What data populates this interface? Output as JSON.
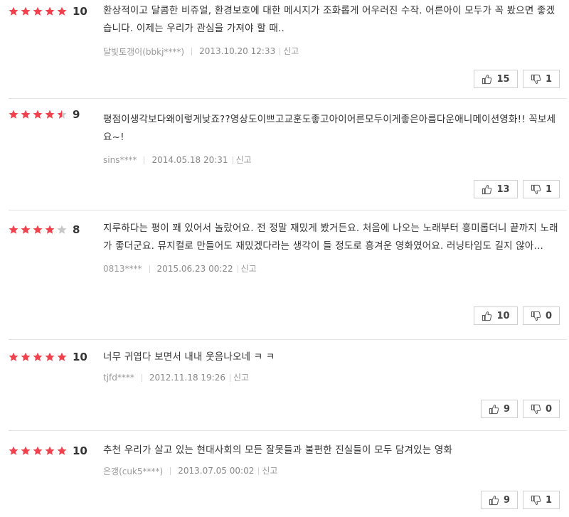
{
  "report_label": "신고",
  "colors": {
    "star_filled": "#f0414c",
    "star_empty": "#c8c8c8",
    "border": "#e3e3e3"
  },
  "icons": {
    "like": "thumbs-up-icon",
    "dislike": "thumbs-down-icon",
    "star": "star-icon"
  },
  "reviews": [
    {
      "rating_stars": 5,
      "score": "10",
      "text": "환상적이고 달콤한 비쥬얼, 환경보호에 대한 메시지가 조화롭게 어우러진 수작. 어른아이 모두가 꼭 봤으면 좋겠습니다. 이제는 우리가 관심을 가져야 할 때..",
      "author": "달빛토갱이(bbkj****)",
      "date": "2013.10.20 12:33",
      "likes": "15",
      "dislikes": "1"
    },
    {
      "rating_stars": 4.5,
      "score": "9",
      "text": "평점이생각보다왜이렇게낮죠??영상도이쁘고교훈도좋고아이어른모두이게좋은아름다운애니메이션영화!! 꼭보세요~!",
      "author": "sins****",
      "date": "2014.05.18 20:31",
      "likes": "13",
      "dislikes": "1"
    },
    {
      "rating_stars": 4,
      "score": "8",
      "text": "지루하다는 평이 꽤 있어서 놀랐어요. 전 정말 재밌게 봤거든요. 처음에 나오는 노래부터 흥미롭더니 끝까지 노래가 좋더군요. 뮤지컬로 만들어도 재밌겠다라는 생각이 들 정도로 흥겨운 영화였어요. 러닝타임도 길지 않아...",
      "author": "0813****",
      "date": "2015.06.23 00:22",
      "likes": "10",
      "dislikes": "0"
    },
    {
      "rating_stars": 5,
      "score": "10",
      "text": "너무 귀엽다 보면서 내내 웃음나오네 ㅋ ㅋ",
      "author": "tjfd****",
      "date": "2012.11.18 19:26",
      "likes": "9",
      "dislikes": "0"
    },
    {
      "rating_stars": 5,
      "score": "10",
      "text": "추천 우리가 살고 있는 현대사회의 모든 잘못들과 불편한 진실들이 모두 담겨있는 영화",
      "author": "은갱(cuk5****)",
      "date": "2013.07.05 00:02",
      "likes": "9",
      "dislikes": "1"
    }
  ]
}
